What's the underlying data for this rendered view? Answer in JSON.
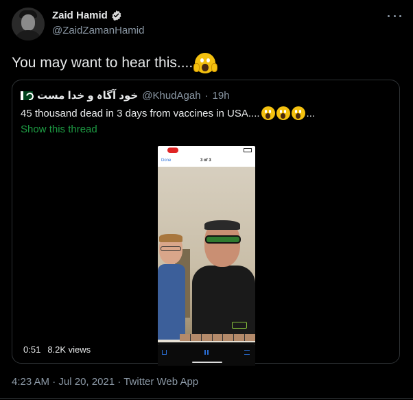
{
  "author": {
    "display_name": "Zaid Hamid",
    "handle": "@ZaidZamanHamid",
    "verified": true,
    "avatar_icon": "avatar-photo-icon"
  },
  "tweet": {
    "text": "You may want to hear this....",
    "emoji": "face-screaming-in-fear"
  },
  "quoted_tweet": {
    "display_name": "خود آگاہ و خدا مست",
    "name_icon": "pakistan-flag-icon",
    "handle": "@KhudAgah",
    "separator": "·",
    "time": "19h",
    "text": "45 thousand dead in 3 days from vaccines in USA....",
    "text_suffix": "...",
    "emoji_count": 3,
    "show_thread": "Show this thread",
    "video": {
      "phone_nav_done": "Done",
      "phone_nav_count": "3 of 3",
      "duration": "0:51",
      "views": "8.2K views"
    }
  },
  "footer": {
    "time": "4:23 AM",
    "separator": "·",
    "date": "Jul 20, 2021",
    "client": "Twitter Web App"
  },
  "colors": {
    "background": "#000000",
    "text_primary": "#e7e9ea",
    "text_secondary": "#8b98a5",
    "verified_badge": "#d9d9d9",
    "thread_link": "#1d9b43",
    "border": "#2f3336"
  }
}
